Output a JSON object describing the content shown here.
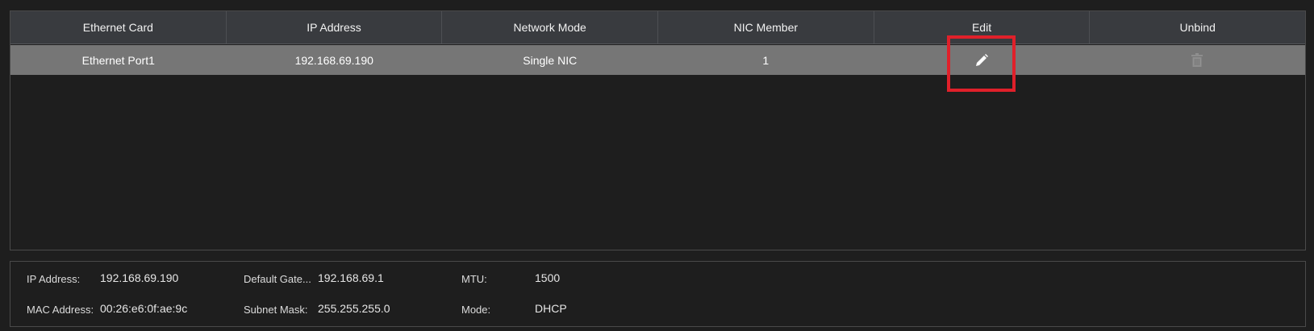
{
  "table": {
    "headers": [
      "Ethernet Card",
      "IP Address",
      "Network Mode",
      "NIC Member",
      "Edit",
      "Unbind"
    ],
    "rows": [
      {
        "ethernet_card": "Ethernet Port1",
        "ip_address": "192.168.69.190",
        "network_mode": "Single NIC",
        "nic_member": "1",
        "edit_icon": "pencil-icon",
        "unbind_icon": "trash-icon"
      }
    ]
  },
  "details": {
    "ip_address_label": "IP Address:",
    "ip_address_value": "192.168.69.190",
    "mac_address_label": "MAC Address:",
    "mac_address_value": "00:26:e6:0f:ae:9c",
    "default_gateway_label": "Default Gate...",
    "default_gateway_value": "192.168.69.1",
    "subnet_mask_label": "Subnet Mask:",
    "subnet_mask_value": "255.255.255.0",
    "mtu_label": "MTU:",
    "mtu_value": "1500",
    "mode_label": "Mode:",
    "mode_value": "DHCP"
  },
  "colors": {
    "highlight": "#e0202a",
    "header_bg": "#393b3f",
    "row_selected_bg": "#767676"
  }
}
